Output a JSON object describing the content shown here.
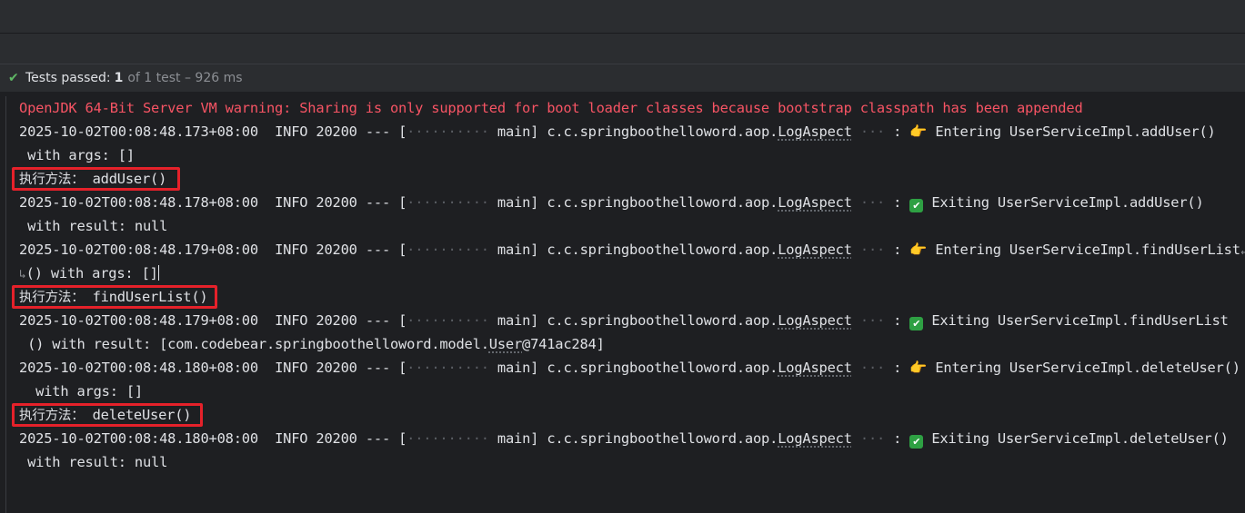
{
  "status": {
    "label": "Tests passed:",
    "count": "1",
    "rest": "of 1 test – 926 ms",
    "icon": "check-icon",
    "color": "#5fb865"
  },
  "console": {
    "warning": "OpenJDK 64-Bit Server VM warning: Sharing is only supported for boot loader classes because bootstrap classpath has been appended",
    "thread_dots": "··········",
    "sep_dots": "···",
    "emoji_entering": "👉",
    "emoji_exiting": "✔",
    "entries": [
      {
        "timestamp": "2025-10-02T00:08:48.173+08:00",
        "level": "INFO",
        "pid": "20200",
        "sep": "---",
        "thread": "main]",
        "pkg": "c.c.springboothelloword.aop.",
        "cls": "LogAspect",
        "message": "Entering UserServiceImpl.addUser()",
        "cont": " with args: []"
      },
      {
        "timestamp": "2025-10-02T00:08:48.178+08:00",
        "level": "INFO",
        "pid": "20200",
        "sep": "---",
        "thread": "main]",
        "pkg": "c.c.springboothelloword.aop.",
        "cls": "LogAspect",
        "message": "Exiting UserServiceImpl.addUser()",
        "cont": " with result: null"
      },
      {
        "timestamp": "2025-10-02T00:08:48.179+08:00",
        "level": "INFO",
        "pid": "20200",
        "sep": "---",
        "thread": "main]",
        "pkg": "c.c.springboothelloword.aop.",
        "cls": "LogAspect",
        "message": "Entering UserServiceImpl.findUserList",
        "cont": "() with args: []"
      },
      {
        "timestamp": "2025-10-02T00:08:48.179+08:00",
        "level": "INFO",
        "pid": "20200",
        "sep": "---",
        "thread": "main]",
        "pkg": "c.c.springboothelloword.aop.",
        "cls": "LogAspect",
        "message": "Exiting UserServiceImpl.findUserList",
        "cont": " () with result: [com.codebear.springboothelloword.model.",
        "cont_cls": "User",
        "cont_tail": "@741ac284]"
      },
      {
        "timestamp": "2025-10-02T00:08:48.180+08:00",
        "level": "INFO",
        "pid": "20200",
        "sep": "---",
        "thread": "main]",
        "pkg": "c.c.springboothelloword.aop.",
        "cls": "LogAspect",
        "message": "Entering UserServiceImpl.deleteUser()",
        "cont": "  with args: []"
      },
      {
        "timestamp": "2025-10-02T00:08:48.180+08:00",
        "level": "INFO",
        "pid": "20200",
        "sep": "---",
        "thread": "main]",
        "pkg": "c.c.springboothelloword.aop.",
        "cls": "LogAspect",
        "message": "Exiting UserServiceImpl.deleteUser()",
        "cont": " with result: null"
      }
    ],
    "exec_label": "执行方法：",
    "exec_methods": [
      "addUser()",
      "findUserList()",
      "deleteUser()"
    ],
    "highlight_color": "#e5212a"
  }
}
